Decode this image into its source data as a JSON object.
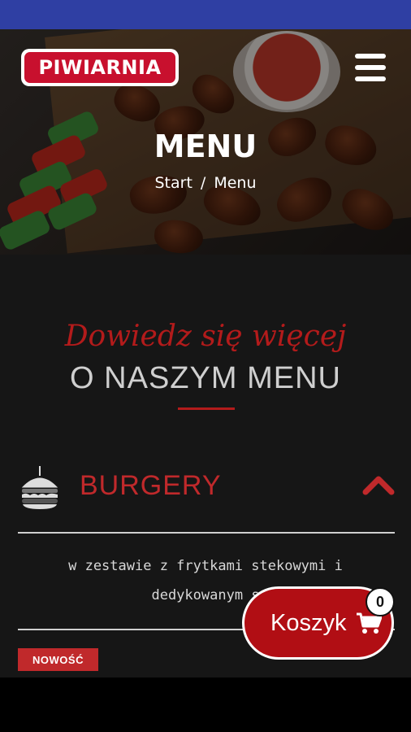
{
  "header": {
    "logo_text": "PIWIARNIA",
    "menu_icon": "hamburger-menu-icon"
  },
  "hero": {
    "title": "MENU",
    "breadcrumb": {
      "items": [
        "Start",
        "Menu"
      ],
      "separator": "/"
    }
  },
  "section": {
    "script_title": "Dowiedz się więcej",
    "main_title": "O NASZYM MENU"
  },
  "category": {
    "icon": "burger-icon",
    "label": "BURGERY",
    "toggle_icon": "chevron-up-icon",
    "description": "w zestawie z frytkami stekowymi i dedykowanym s"
  },
  "badge": {
    "new_label": "NOWOŚĆ"
  },
  "cart": {
    "label": "Koszyk",
    "icon": "cart-icon",
    "count": "0"
  },
  "colors": {
    "accent_red": "#c0292b",
    "status_bar": "#2f3fa3",
    "background": "#161616"
  }
}
